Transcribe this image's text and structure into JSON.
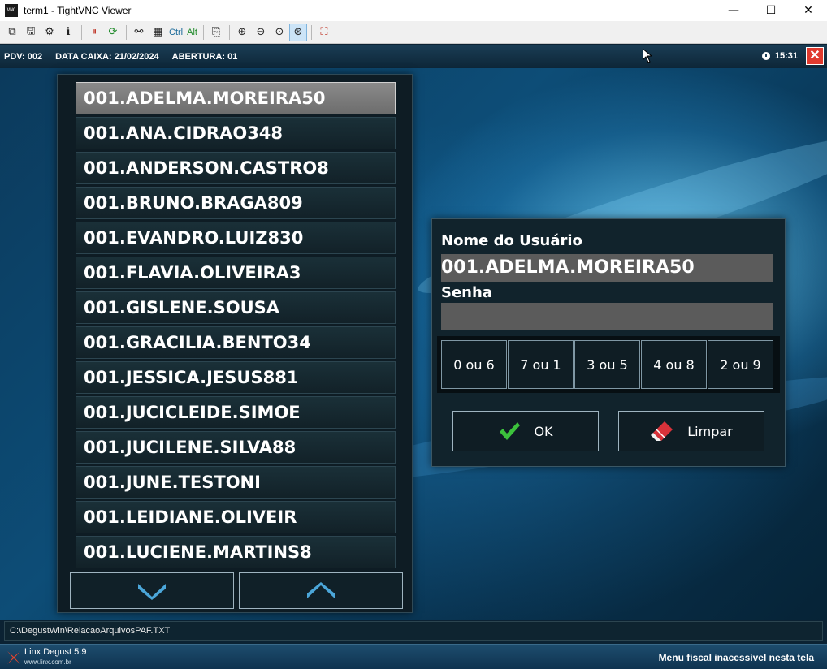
{
  "window": {
    "icon_text": "VNC",
    "title": "term1 - TightVNC Viewer",
    "minimize_glyph": "—",
    "maximize_glyph": "☐",
    "close_glyph": "✕"
  },
  "toolbar": {
    "buttons": [
      {
        "name": "new-connection-icon",
        "glyph": "⧉"
      },
      {
        "name": "save-icon",
        "glyph": "🖫"
      },
      {
        "name": "options-icon",
        "glyph": "⚙"
      },
      {
        "name": "connection-info-icon",
        "glyph": "ℹ"
      },
      {
        "name": "pause-icon",
        "glyph": "⏸"
      },
      {
        "name": "refresh-icon",
        "glyph": "⟳"
      },
      {
        "name": "ctrl-alt-del-icon",
        "glyph": "⚯"
      },
      {
        "name": "ctrl-esc-icon",
        "glyph": "▦"
      },
      {
        "name": "copy-icon",
        "glyph": "⎘"
      },
      {
        "name": "zoom-in-icon",
        "glyph": "⊕"
      },
      {
        "name": "zoom-out-icon",
        "glyph": "⊖"
      },
      {
        "name": "zoom-100-icon",
        "glyph": "⊙"
      },
      {
        "name": "zoom-fit-icon",
        "glyph": "⊛"
      },
      {
        "name": "fullscreen-icon",
        "glyph": "⛶"
      }
    ],
    "ctrl_label": "Ctrl",
    "alt_label": "Alt"
  },
  "status": {
    "pdv": "PDV: 002",
    "data_caixa": "DATA CAIXA: 21/02/2024",
    "abertura": "ABERTURA: 01",
    "time": "15:31",
    "close_glyph": "✕"
  },
  "users": {
    "items": [
      "001.ADELMA.MOREIRA50",
      "001.ANA.CIDRAO348",
      "001.ANDERSON.CASTRO8",
      "001.BRUNO.BRAGA809",
      "001.EVANDRO.LUIZ830",
      "001.FLAVIA.OLIVEIRA3",
      "001.GISLENE.SOUSA",
      "001.GRACILIA.BENTO34",
      "001.JESSICA.JESUS881",
      "001.JUCICLEIDE.SIMOE",
      "001.JUCILENE.SILVA88",
      "001.JUNE.TESTONI",
      "001.LEIDIANE.OLIVEIR",
      "001.LUCIENE.MARTINS8"
    ],
    "selected_index": 0
  },
  "login": {
    "user_label": "Nome do Usuário",
    "user_value": "001.ADELMA.MOREIRA50",
    "password_label": "Senha",
    "password_value": "",
    "keypad": [
      "0 ou 6",
      "7 ou 1",
      "3 ou 5",
      "4 ou 8",
      "2 ou 9"
    ],
    "ok_label": "OK",
    "clear_label": "Limpar"
  },
  "path": "C:\\DegustWin\\RelacaoArquivosPAF.TXT",
  "footer": {
    "brand": "Linx Degust 5.9",
    "url": "www.linx.com.br",
    "message": "Menu fiscal inacessível nesta tela"
  },
  "colors": {
    "selected_row": "#7a7a7a",
    "ok_check": "#3cc23c",
    "clear_eraser": "#d8323a",
    "chevron": "#4ba6d9"
  }
}
